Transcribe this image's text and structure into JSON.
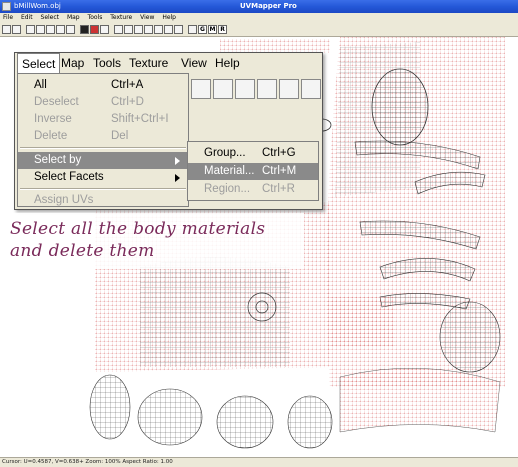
{
  "window": {
    "title": "bMillWom.obj",
    "app_title": "UVMapper Pro"
  },
  "small_menu": [
    "File",
    "Edit",
    "Select",
    "Map",
    "Tools",
    "Texture",
    "View",
    "Help"
  ],
  "toolbar": {
    "letters": [
      "G",
      "M",
      "R"
    ]
  },
  "menubar": {
    "items": [
      "Select",
      "Map",
      "Tools",
      "Texture",
      "View",
      "Help"
    ]
  },
  "select_menu": {
    "items": [
      {
        "label": "All",
        "shortcut": "Ctrl+A",
        "enabled": true
      },
      {
        "label": "Deselect",
        "shortcut": "Ctrl+D",
        "enabled": false
      },
      {
        "label": "Inverse",
        "shortcut": "Shift+Ctrl+I",
        "enabled": false
      },
      {
        "label": "Delete",
        "shortcut": "Del",
        "enabled": false
      },
      {
        "label": "Select by",
        "shortcut": "",
        "enabled": true,
        "highlighted": true
      },
      {
        "label": "Select Facets",
        "shortcut": "",
        "enabled": true
      },
      {
        "label": "Assign UVs",
        "shortcut": "",
        "enabled": false
      }
    ]
  },
  "submenu": {
    "items": [
      {
        "label": "Group...",
        "shortcut": "Ctrl+G",
        "enabled": true
      },
      {
        "label": "Material...",
        "shortcut": "Ctrl+M",
        "enabled": true,
        "highlighted": true
      },
      {
        "label": "Region...",
        "shortcut": "Ctrl+R",
        "enabled": false
      }
    ]
  },
  "annotation": {
    "line1": "Select all the body materials",
    "line2": "and delete them"
  },
  "status": {
    "text": "Cursor: U=0.4587, V=0.638+  Zoom: 100%  Aspect Ratio: 1.00"
  },
  "colors": {
    "mesh_red": "#d04040",
    "mesh_black": "#333333",
    "highlight": "#8a8a8a",
    "annotation": "#7a2a5a"
  }
}
